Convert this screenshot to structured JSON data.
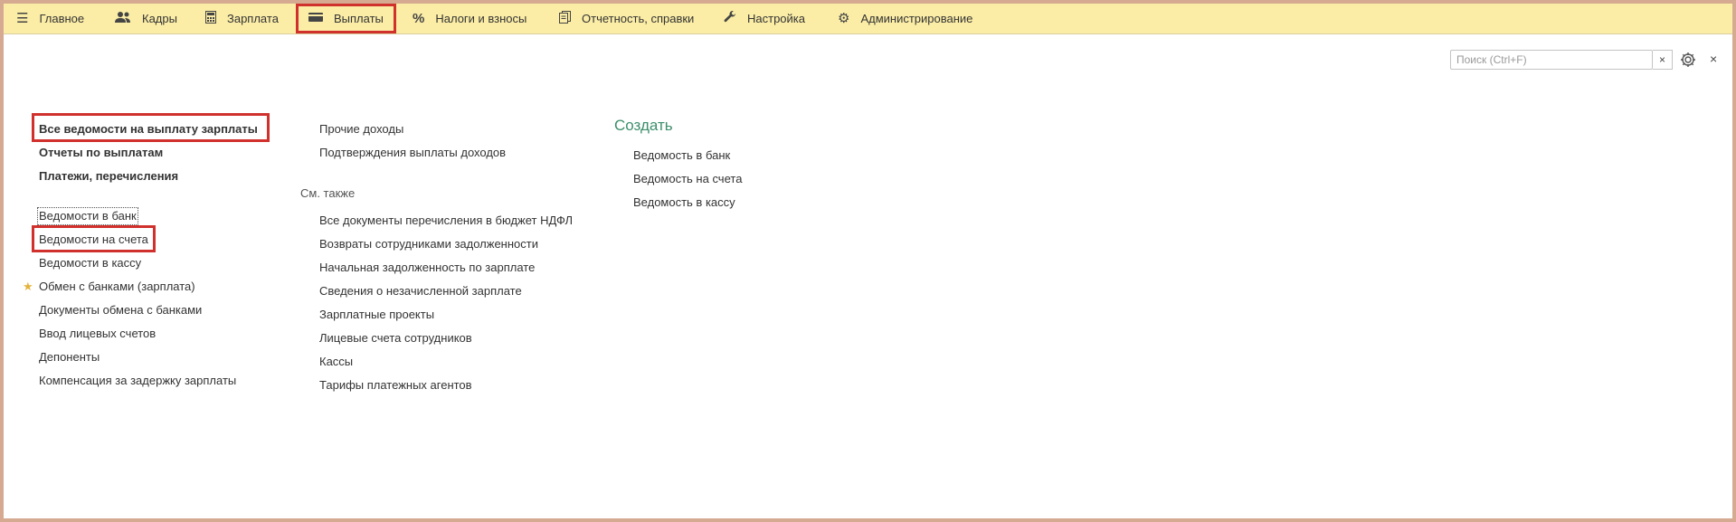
{
  "nav": {
    "items": [
      {
        "label": "Главное",
        "icon": "hamburger-icon"
      },
      {
        "label": "Кадры",
        "icon": "people-icon"
      },
      {
        "label": "Зарплата",
        "icon": "calculator-icon"
      },
      {
        "label": "Выплаты",
        "icon": "wallet-icon"
      },
      {
        "label": "Налоги и взносы",
        "icon": "percent-icon"
      },
      {
        "label": "Отчетность, справки",
        "icon": "documents-icon"
      },
      {
        "label": "Настройка",
        "icon": "wrench-icon"
      },
      {
        "label": "Администрирование",
        "icon": "gear-icon"
      }
    ]
  },
  "search": {
    "placeholder": "Поиск (Ctrl+F)",
    "clear": "×"
  },
  "close": "×",
  "col1": {
    "bold": [
      "Все ведомости на выплату зарплаты",
      "Отчеты по выплатам",
      "Платежи, перечисления"
    ],
    "links": [
      "Ведомости в банк",
      "Ведомости на счета",
      "Ведомости в кассу",
      "Обмен с банками (зарплата)",
      "Документы обмена с банками",
      "Ввод лицевых счетов",
      "Депоненты",
      "Компенсация за задержку зарплаты"
    ]
  },
  "col2": {
    "links": [
      "Прочие доходы",
      "Подтверждения выплаты доходов"
    ],
    "see_also_label": "См. также",
    "see_also": [
      "Все документы перечисления в бюджет НДФЛ",
      "Возвраты сотрудниками задолженности",
      "Начальная задолженность по зарплате",
      "Сведения о незачисленной зарплате",
      "Зарплатные проекты",
      "Лицевые счета сотрудников",
      "Кассы",
      "Тарифы платежных агентов"
    ]
  },
  "col3": {
    "title": "Создать",
    "links": [
      "Ведомость в банк",
      "Ведомость на счета",
      "Ведомость в кассу"
    ]
  },
  "colors": {
    "topbar": "#fbeda6",
    "highlight": "#d0312d",
    "create": "#3d8f6c",
    "star": "#e5b33b"
  }
}
